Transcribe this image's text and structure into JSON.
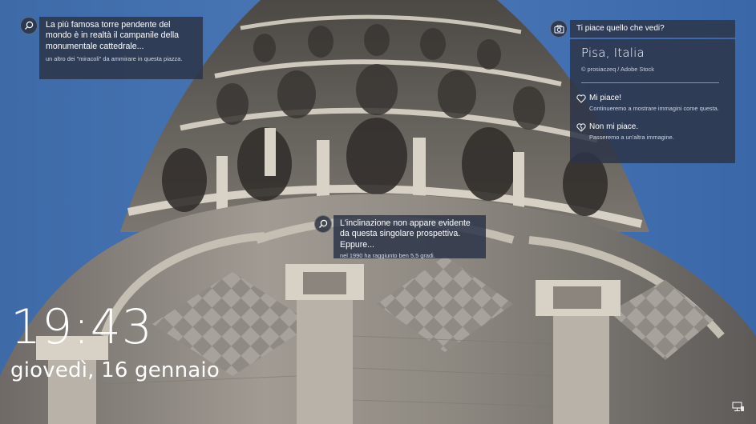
{
  "hotspots": [
    {
      "icon": "search-icon",
      "main": "La più famosa torre pendente del mondo è in realtà il campanile della monumentale cattedrale...",
      "sub": "un altro dei \"miracoli\" da ammirare in questa piazza."
    },
    {
      "icon": "search-icon",
      "main": "L'inclinazione non appare evidente da questa singolare prospettiva. Eppure...",
      "sub": "nel 1990 ha raggiunto ben 5,5 gradi."
    }
  ],
  "feedback": {
    "icon": "camera-icon",
    "question": "Ti piace quello che vedi?",
    "place": "Pisa, Italia",
    "credit": "© prosiaczeq / Adobe Stock",
    "like": {
      "title": "Mi piace!",
      "desc": "Continueremo a mostrare immagini come questa."
    },
    "dislike": {
      "title": "Non mi piace.",
      "desc": "Passeremo a un'altra immagine."
    }
  },
  "clock": {
    "time": "19:43",
    "date": "giovedì, 16 gennaio"
  },
  "system_tray": {
    "network_icon": "network-icon"
  }
}
